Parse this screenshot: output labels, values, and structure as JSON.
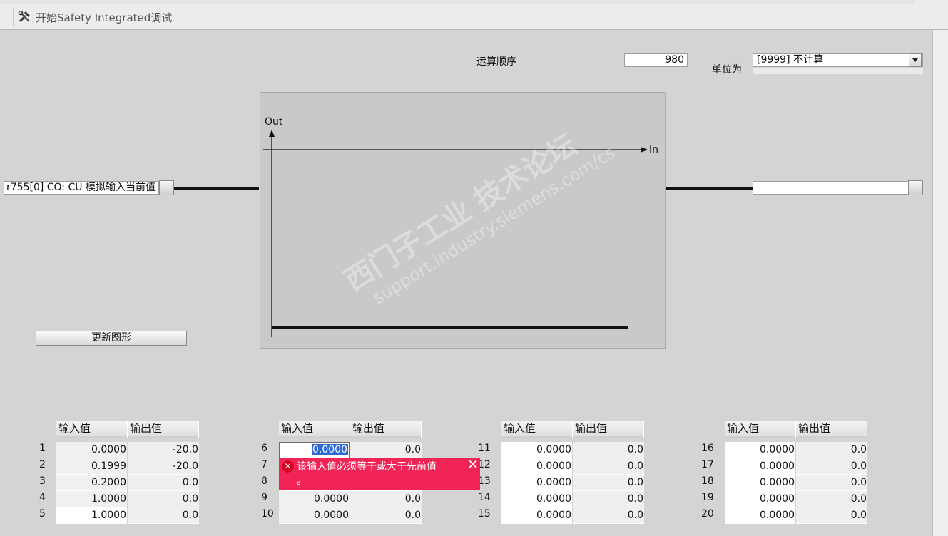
{
  "toolbar": {
    "title": "开始Safety Integrated调试",
    "icon": "tools-icon"
  },
  "form": {
    "calc_order_label": "运算顺序",
    "calc_order_value": "980",
    "unit_label": "单位为",
    "unit_value": "[9999] 不计算"
  },
  "input_signal": {
    "value": "r755[0] CO: CU 模拟输入当前值"
  },
  "output_signal": {
    "value": ""
  },
  "chart": {
    "y_axis_label": "Out",
    "x_axis_label": "In"
  },
  "update_button": {
    "label": "更新图形"
  },
  "table_headers": {
    "input": "输入值",
    "output": "输出值"
  },
  "tables": [
    {
      "rows": [
        {
          "n": "1",
          "input": "0.0000",
          "output": "-20.0"
        },
        {
          "n": "2",
          "input": "0.1999",
          "output": "-20.0"
        },
        {
          "n": "3",
          "input": "0.2000",
          "output": "0.0"
        },
        {
          "n": "4",
          "input": "1.0000",
          "output": "0.0"
        },
        {
          "n": "5",
          "input": "1.0000",
          "output": "0.0"
        }
      ]
    },
    {
      "rows": [
        {
          "n": "6",
          "input": "0.0000",
          "output": "0.0"
        },
        {
          "n": "7",
          "input": "",
          "output": ""
        },
        {
          "n": "8",
          "input": "",
          "output": ""
        },
        {
          "n": "9",
          "input": "0.0000",
          "output": "0.0"
        },
        {
          "n": "10",
          "input": "0.0000",
          "output": "0.0"
        }
      ]
    },
    {
      "rows": [
        {
          "n": "11",
          "input": "0.0000",
          "output": "0.0"
        },
        {
          "n": "12",
          "input": "0.0000",
          "output": "0.0"
        },
        {
          "n": "13",
          "input": "0.0000",
          "output": "0.0"
        },
        {
          "n": "14",
          "input": "0.0000",
          "output": "0.0"
        },
        {
          "n": "15",
          "input": "0.0000",
          "output": "0.0"
        }
      ]
    },
    {
      "rows": [
        {
          "n": "16",
          "input": "0.0000",
          "output": "0.0"
        },
        {
          "n": "17",
          "input": "0.0000",
          "output": "0.0"
        },
        {
          "n": "18",
          "input": "0.0000",
          "output": "0.0"
        },
        {
          "n": "19",
          "input": "0.0000",
          "output": "0.0"
        },
        {
          "n": "20",
          "input": "0.0000",
          "output": "0.0"
        }
      ]
    }
  ],
  "error_tooltip": {
    "message": "该输入值必须等于或大于先前值",
    "message_end": "。",
    "close": "✕"
  },
  "watermark": {
    "line1": "西门子工业 技术论坛",
    "line2": "support.industry.siemens.com/cs"
  },
  "colors": {
    "error_bg": "#f02457",
    "selection": "#2e6ad4"
  }
}
